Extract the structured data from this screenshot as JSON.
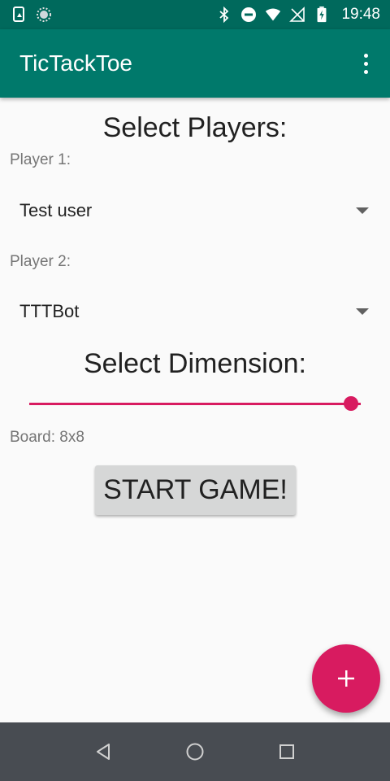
{
  "status_bar": {
    "time": "19:48",
    "icons": [
      "screenshot-icon",
      "sync-icon",
      "bluetooth-icon",
      "do-not-disturb-icon",
      "wifi-icon",
      "no-signal-icon",
      "battery-charging-icon"
    ]
  },
  "app_bar": {
    "title": "TicTackToe",
    "overflow_icon": "more-vert-icon"
  },
  "main": {
    "select_players_heading": "Select Players:",
    "player1": {
      "label": "Player 1:",
      "value": "Test user"
    },
    "player2": {
      "label": "Player 2:",
      "value": "TTTBot"
    },
    "select_dimension_heading": "Select Dimension:",
    "dimension_slider": {
      "fraction": 0.97
    },
    "board_label": "Board: 8x8",
    "start_button_label": "START GAME!"
  },
  "fab": {
    "icon": "plus-icon"
  },
  "nav_bar": {
    "icons": [
      "back-icon",
      "home-icon",
      "recents-icon"
    ]
  },
  "colors": {
    "status_bar": "#00695c",
    "app_bar": "#00796b",
    "accent": "#d81b60",
    "background": "#fafafa",
    "nav_bar": "#484c52"
  }
}
